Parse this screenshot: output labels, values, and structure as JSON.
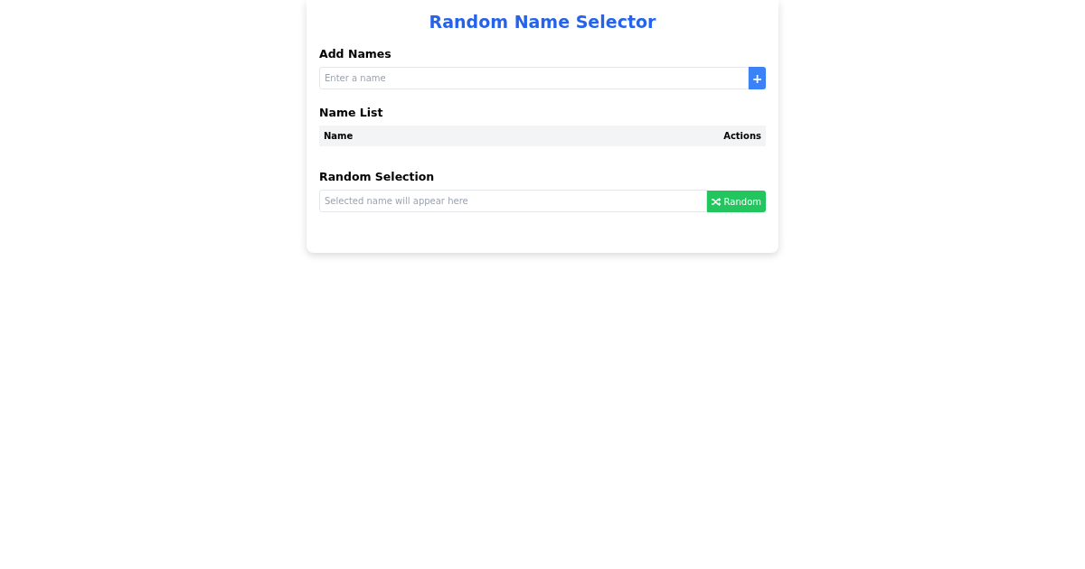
{
  "title": "Random Name Selector",
  "add_section": {
    "heading": "Add Names",
    "placeholder": "Enter a name",
    "button": "+"
  },
  "name_list": {
    "heading": "Name List",
    "columns": [
      "Name",
      "Actions"
    ]
  },
  "random_section": {
    "heading": "Random Selection",
    "placeholder": "Selected name will appear here",
    "button": "Random"
  }
}
